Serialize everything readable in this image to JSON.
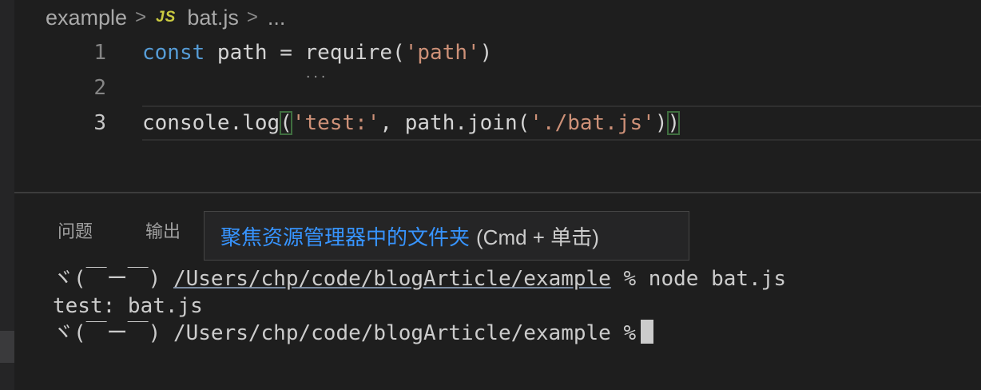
{
  "breadcrumb": {
    "folder": "example",
    "file_icon": "JS",
    "file": "bat.js",
    "more": "..."
  },
  "editor": {
    "lines": [
      {
        "number": "1"
      },
      {
        "number": "2"
      },
      {
        "number": "3"
      }
    ],
    "line1": {
      "kw": "const",
      "var": " path = ",
      "fn": "require",
      "open": "(",
      "str": "'path'",
      "close": ")"
    },
    "line3": {
      "obj": "console.log",
      "open": "(",
      "str1": "'test:'",
      "mid": ", path.join(",
      "str2": "'./bat.js'",
      "close1": ")",
      "close2": ")"
    }
  },
  "panel": {
    "tabs": [
      "问题",
      "输出"
    ],
    "tooltip": {
      "main": "聚焦资源管理器中的文件夹",
      "hint": "(Cmd + 单击)"
    },
    "terminal": {
      "prompt": "ヾ(￣ー￣) ",
      "path_link": "/Users/chp/code/blogArticle/example",
      "cmd1": " % node bat.js",
      "output": "test: bat.js",
      "prompt2": "ヾ(￣ー￣) /Users/chp/code/blogArticle/example %"
    }
  },
  "colors": {
    "keyword": "#569cd6",
    "string": "#ce9178",
    "link": "#3794ff",
    "js_icon": "#cbcb41"
  }
}
